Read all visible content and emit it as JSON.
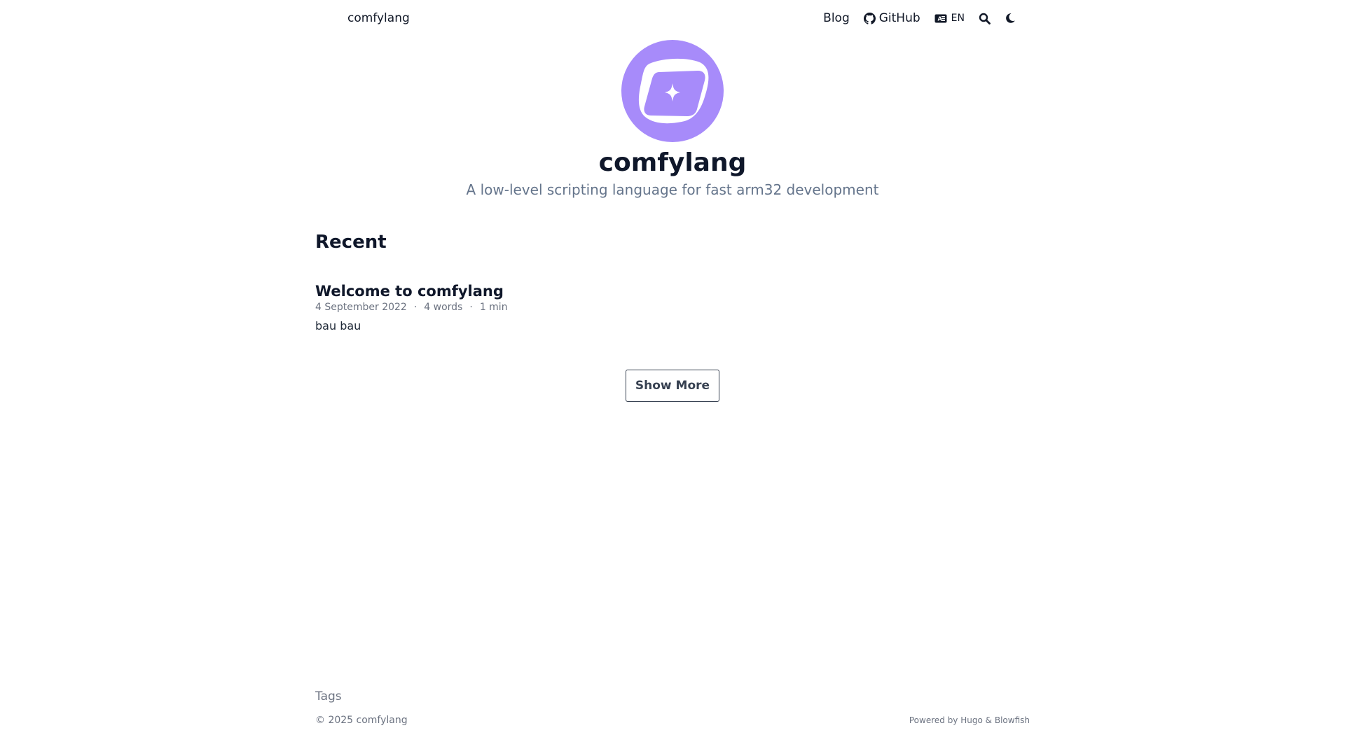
{
  "header": {
    "brand": "comfylang",
    "nav": {
      "blog": "Blog",
      "github": "GitHub",
      "language": "EN"
    },
    "icons": [
      "github-icon",
      "translate-icon",
      "search-icon",
      "moon-icon"
    ]
  },
  "hero": {
    "title": "comfylang",
    "subtitle": "A low-level scripting language for fast arm32 development",
    "logo_colors": {
      "circle": "#a78bfa",
      "frame": "#ffffff",
      "inner": "#a78bfa"
    }
  },
  "recent": {
    "heading": "Recent",
    "articles": [
      {
        "title": "Welcome to comfylang",
        "date": "4 September 2022",
        "words": "4 words",
        "reading_time": "1 min",
        "summary": "bau bau"
      }
    ],
    "meta_separator": "·",
    "show_more": "Show More"
  },
  "footer": {
    "tags": "Tags",
    "copyright": "© 2025 comfylang",
    "powered_prefix": "Powered by",
    "hugo": "Hugo",
    "amp": "&",
    "blowfish": "Blowfish"
  },
  "colors": {
    "text": "#0f172a",
    "muted": "#6b7280",
    "accent": "#a78bfa"
  }
}
